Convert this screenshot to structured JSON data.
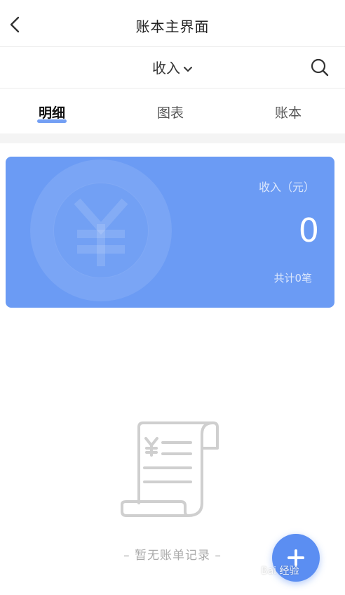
{
  "nav": {
    "title": "账本主界面"
  },
  "filter": {
    "type_label": "收入"
  },
  "tabs": [
    {
      "label": "明细",
      "active": true
    },
    {
      "label": "图表",
      "active": false
    },
    {
      "label": "账本",
      "active": false
    }
  ],
  "summary": {
    "label": "收入（元）",
    "amount": "0",
    "count": "共计0笔",
    "card_color": "#6b9bf4"
  },
  "empty": {
    "text": "– 暂无账单记录 –"
  },
  "fab": {
    "icon": "plus-icon",
    "color": "#5b8ef2"
  },
  "watermark": {
    "text": "Bai 经验"
  },
  "accent": "#5b8ef2"
}
